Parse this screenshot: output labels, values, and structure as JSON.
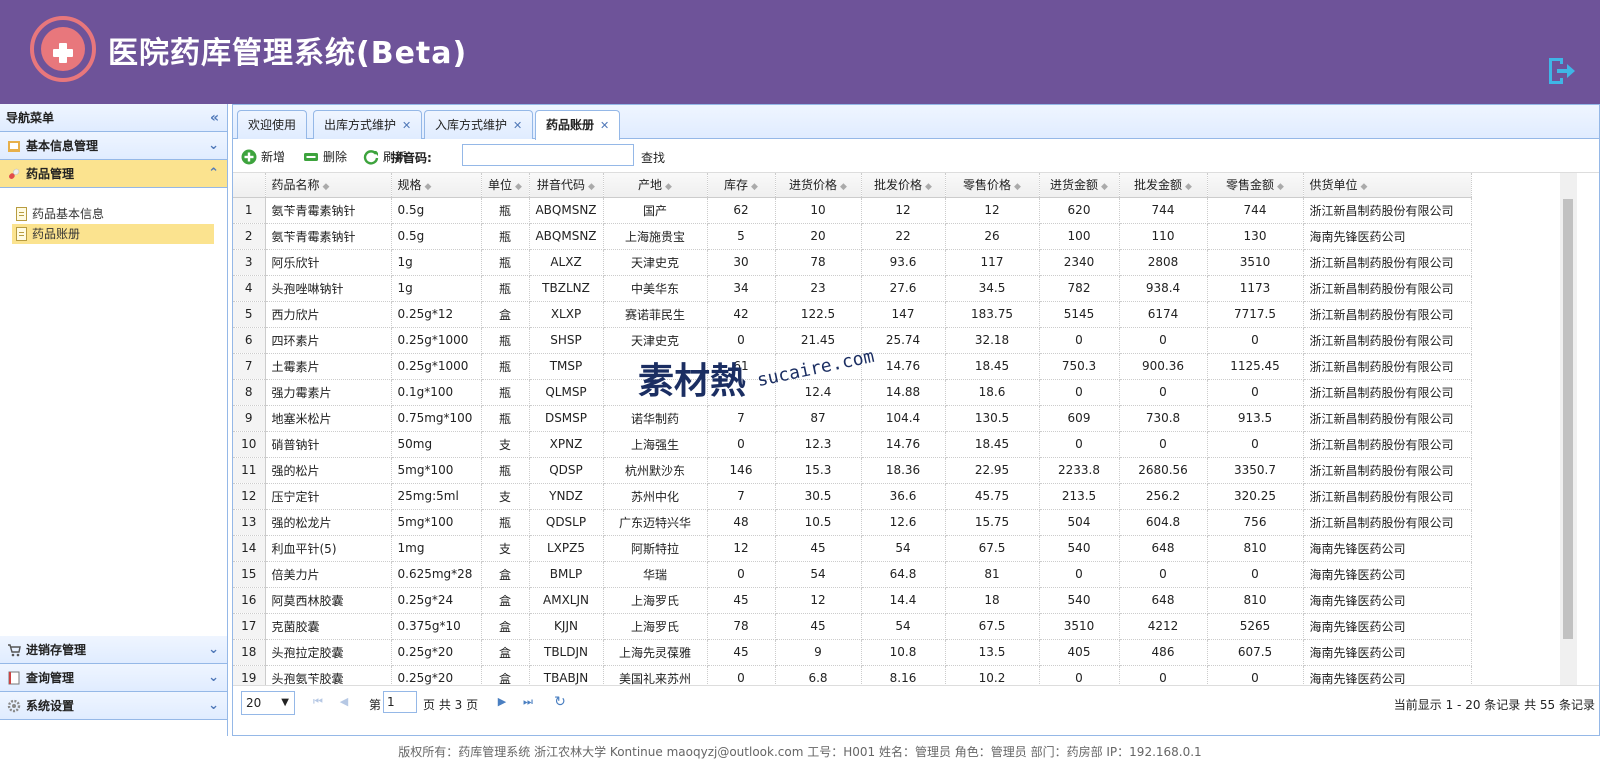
{
  "app": {
    "title": "医院药库管理系统(Beta)"
  },
  "nav": {
    "title": "导航菜单",
    "sections": [
      {
        "label": "基本信息管理"
      },
      {
        "label": "药品管理"
      },
      {
        "label": "进销存管理"
      },
      {
        "label": "查询管理"
      },
      {
        "label": "系统设置"
      }
    ],
    "items": [
      {
        "label": "药品基本信息"
      },
      {
        "label": "药品账册"
      }
    ]
  },
  "tabs": [
    {
      "label": "欢迎使用"
    },
    {
      "label": "出库方式维护"
    },
    {
      "label": "入库方式维护"
    },
    {
      "label": "药品账册"
    }
  ],
  "toolbar": {
    "add_label": "新增",
    "delete_label": "删除",
    "refresh_label": "刷新",
    "pinyin_label": "拼音码:",
    "pinyin_value": "",
    "search_label": "查找"
  },
  "grid": {
    "columns": [
      "药品名称",
      "规格",
      "单位",
      "拼音代码",
      "产地",
      "库存",
      "进货价格",
      "批发价格",
      "零售价格",
      "进货金额",
      "批发金额",
      "零售金额",
      "供货单位"
    ],
    "rows": [
      [
        "1",
        "氨苄青霉素钠针",
        "0.5g",
        "瓶",
        "ABQMSNZ",
        "国产",
        "62",
        "10",
        "12",
        "12",
        "620",
        "744",
        "744",
        "浙江新昌制药股份有限公司"
      ],
      [
        "2",
        "氨苄青霉素钠针",
        "0.5g",
        "瓶",
        "ABQMSNZ",
        "上海施贵宝",
        "5",
        "20",
        "22",
        "26",
        "100",
        "110",
        "130",
        "海南先锋医药公司"
      ],
      [
        "3",
        "阿乐欣针",
        "1g",
        "瓶",
        "ALXZ",
        "天津史克",
        "30",
        "78",
        "93.6",
        "117",
        "2340",
        "2808",
        "3510",
        "浙江新昌制药股份有限公司"
      ],
      [
        "4",
        "头孢唑啉钠针",
        "1g",
        "瓶",
        "TBZLNZ",
        "中美华东",
        "34",
        "23",
        "27.6",
        "34.5",
        "782",
        "938.4",
        "1173",
        "浙江新昌制药股份有限公司"
      ],
      [
        "5",
        "西力欣片",
        "0.25g*12",
        "盒",
        "XLXP",
        "赛诺菲民生",
        "42",
        "122.5",
        "147",
        "183.75",
        "5145",
        "6174",
        "7717.5",
        "浙江新昌制药股份有限公司"
      ],
      [
        "6",
        "四环素片",
        "0.25g*1000",
        "瓶",
        "SHSP",
        "天津史克",
        "0",
        "21.45",
        "25.74",
        "32.18",
        "0",
        "0",
        "0",
        "浙江新昌制药股份有限公司"
      ],
      [
        "7",
        "土霉素片",
        "0.25g*1000",
        "瓶",
        "TMSP",
        "",
        "61",
        "",
        "14.76",
        "18.45",
        "750.3",
        "900.36",
        "1125.45",
        "浙江新昌制药股份有限公司"
      ],
      [
        "8",
        "强力霉素片",
        "0.1g*100",
        "瓶",
        "QLMSP",
        "",
        "",
        "12.4",
        "14.88",
        "18.6",
        "0",
        "0",
        "0",
        "浙江新昌制药股份有限公司"
      ],
      [
        "9",
        "地塞米松片",
        "0.75mg*100",
        "瓶",
        "DSMSP",
        "诺华制药",
        "7",
        "87",
        "104.4",
        "130.5",
        "609",
        "730.8",
        "913.5",
        "浙江新昌制药股份有限公司"
      ],
      [
        "10",
        "硝普钠针",
        "50mg",
        "支",
        "XPNZ",
        "上海强生",
        "0",
        "12.3",
        "14.76",
        "18.45",
        "0",
        "0",
        "0",
        "浙江新昌制药股份有限公司"
      ],
      [
        "11",
        "强的松片",
        "5mg*100",
        "瓶",
        "QDSP",
        "杭州默沙东",
        "146",
        "15.3",
        "18.36",
        "22.95",
        "2233.8",
        "2680.56",
        "3350.7",
        "浙江新昌制药股份有限公司"
      ],
      [
        "12",
        "压宁定针",
        "25mg:5ml",
        "支",
        "YNDZ",
        "苏州中化",
        "7",
        "30.5",
        "36.6",
        "45.75",
        "213.5",
        "256.2",
        "320.25",
        "浙江新昌制药股份有限公司"
      ],
      [
        "13",
        "强的松龙片",
        "5mg*100",
        "瓶",
        "QDSLP",
        "广东迈特兴华",
        "48",
        "10.5",
        "12.6",
        "15.75",
        "504",
        "604.8",
        "756",
        "浙江新昌制药股份有限公司"
      ],
      [
        "14",
        "利血平针(5)",
        "1mg",
        "支",
        "LXPZ5",
        "阿斯特拉",
        "12",
        "45",
        "54",
        "67.5",
        "540",
        "648",
        "810",
        "海南先锋医药公司"
      ],
      [
        "15",
        "倍美力片",
        "0.625mg*28",
        "盒",
        "BMLP",
        "华瑞",
        "0",
        "54",
        "64.8",
        "81",
        "0",
        "0",
        "0",
        "海南先锋医药公司"
      ],
      [
        "16",
        "阿莫西林胶囊",
        "0.25g*24",
        "盒",
        "AMXLJN",
        "上海罗氏",
        "45",
        "12",
        "14.4",
        "18",
        "540",
        "648",
        "810",
        "海南先锋医药公司"
      ],
      [
        "17",
        "克菌胶囊",
        "0.375g*10",
        "盒",
        "KJJN",
        "上海罗氏",
        "78",
        "45",
        "54",
        "67.5",
        "3510",
        "4212",
        "5265",
        "海南先锋医药公司"
      ],
      [
        "18",
        "头孢拉定胶囊",
        "0.25g*20",
        "盒",
        "TBLDJN",
        "上海先灵葆雅",
        "45",
        "9",
        "10.8",
        "13.5",
        "405",
        "486",
        "607.5",
        "海南先锋医药公司"
      ],
      [
        "19",
        "头孢氨苄胶囊",
        "0.25g*20",
        "盒",
        "TBABJN",
        "美国礼来苏州",
        "0",
        "6.8",
        "8.16",
        "10.2",
        "0",
        "0",
        "0",
        "海南先锋医药公司"
      ]
    ]
  },
  "pager": {
    "page_size": "20",
    "page_prefix": "第",
    "current_page": "1",
    "page_suffix": "页 共 3 页",
    "info": "当前显示 1 - 20 条记录 共 55 条记录"
  },
  "footer": {
    "text": "版权所有：药库管理系统 浙江农林大学 Kontinue maoqyzj@outlook.com 工号：H001 姓名：管理员 角色：管理员 部门：药房部 IP：192.168.0.1"
  },
  "watermark": {
    "brand": "素材熱",
    "url": "sucaire.com"
  },
  "colors": {
    "header_bg": "#6e5399",
    "logo": "#e8777c",
    "selected": "#fbe38f",
    "border": "#95b8e7"
  }
}
